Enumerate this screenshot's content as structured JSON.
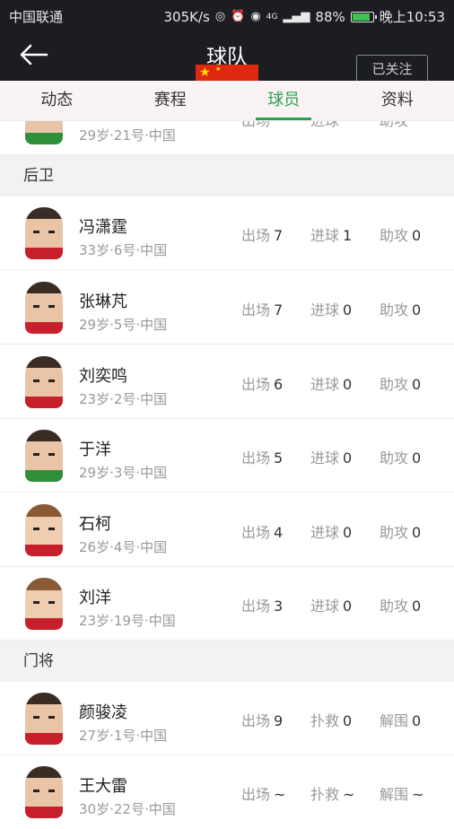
{
  "status_bar": {
    "carrier": "中国联通",
    "speed": "305K/s",
    "network": "4G",
    "battery": "88%",
    "battery_level": 0.88,
    "time": "晚上10:53"
  },
  "header": {
    "title": "球队",
    "follow_label": "已关注"
  },
  "tabs": [
    {
      "label": "动态"
    },
    {
      "label": "赛程"
    },
    {
      "label": "球员",
      "active": true
    },
    {
      "label": "资料"
    }
  ],
  "partial_row": {
    "meta": "29岁·21号·中国",
    "stat_labels": [
      "出场",
      "进球",
      "助攻"
    ]
  },
  "defenders": {
    "section_title": "后卫",
    "players": [
      {
        "name": "冯潇霆",
        "meta": "33岁·6号·中国",
        "s1_label": "出场",
        "s1": "7",
        "s2_label": "进球",
        "s2": "1",
        "s3_label": "助攻",
        "s3": "0"
      },
      {
        "name": "张琳芃",
        "meta": "29岁·5号·中国",
        "s1_label": "出场",
        "s1": "7",
        "s2_label": "进球",
        "s2": "0",
        "s3_label": "助攻",
        "s3": "0"
      },
      {
        "name": "刘奕鸣",
        "meta": "23岁·2号·中国",
        "s1_label": "出场",
        "s1": "6",
        "s2_label": "进球",
        "s2": "0",
        "s3_label": "助攻",
        "s3": "0"
      },
      {
        "name": "于洋",
        "meta": "29岁·3号·中国",
        "s1_label": "出场",
        "s1": "5",
        "s2_label": "进球",
        "s2": "0",
        "s3_label": "助攻",
        "s3": "0"
      },
      {
        "name": "石柯",
        "meta": "26岁·4号·中国",
        "s1_label": "出场",
        "s1": "4",
        "s2_label": "进球",
        "s2": "0",
        "s3_label": "助攻",
        "s3": "0"
      },
      {
        "name": "刘洋",
        "meta": "23岁·19号·中国",
        "s1_label": "出场",
        "s1": "3",
        "s2_label": "进球",
        "s2": "0",
        "s3_label": "助攻",
        "s3": "0"
      }
    ]
  },
  "goalkeepers": {
    "section_title": "门将",
    "players": [
      {
        "name": "颜骏凌",
        "meta": "27岁·1号·中国",
        "s1_label": "出场",
        "s1": "9",
        "s2_label": "扑救",
        "s2": "0",
        "s3_label": "解围",
        "s3": "0"
      },
      {
        "name": "王大雷",
        "meta": "30岁·22号·中国",
        "s1_label": "出场",
        "s1": "~",
        "s2_label": "扑救",
        "s2": "~",
        "s3_label": "解围",
        "s3": "~"
      }
    ]
  },
  "colors": {
    "accent": "#2ba24c",
    "dark_bar": "#1b1d22",
    "flag_red": "#de2910"
  }
}
